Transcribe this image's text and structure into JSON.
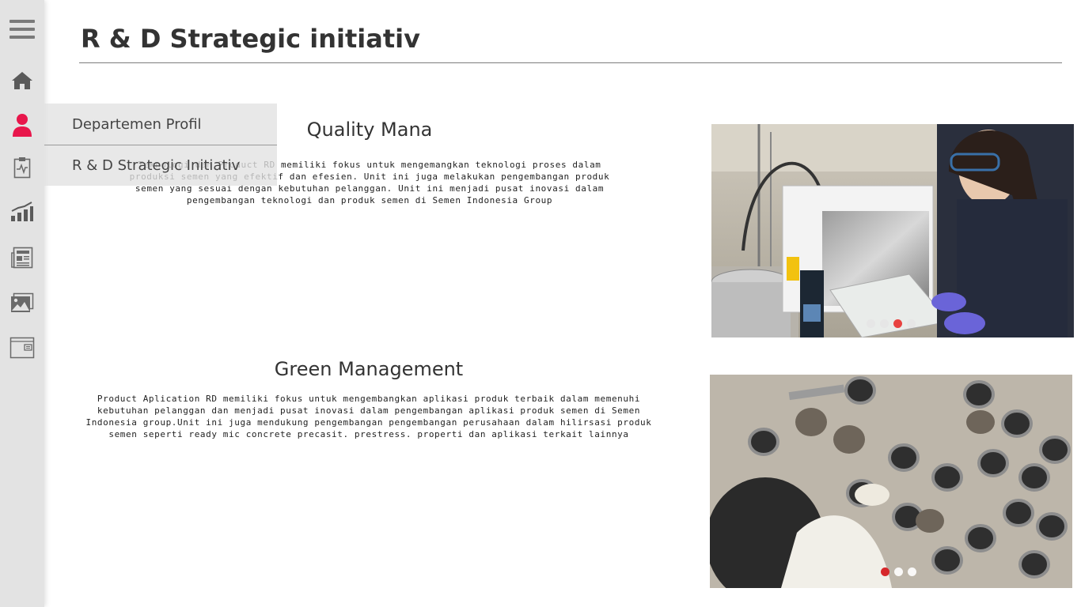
{
  "header": {
    "title": "R & D Strategic initiativ"
  },
  "sidebar": {
    "items": [
      {
        "icon": "menu-icon"
      },
      {
        "icon": "home-icon"
      },
      {
        "icon": "user-icon",
        "active": true,
        "active_color": "#e8164b"
      },
      {
        "icon": "clipboard-icon"
      },
      {
        "icon": "chart-icon"
      },
      {
        "icon": "newspaper-icon"
      },
      {
        "icon": "gallery-icon"
      },
      {
        "icon": "window-icon"
      }
    ]
  },
  "dropdown": {
    "items": [
      {
        "label": "Departemen Profil"
      },
      {
        "label": "R & D Strategic Initiativ"
      }
    ]
  },
  "sections": [
    {
      "title": "Quality Mana",
      "text": "Teknologi dan Product RD memiliki fokus untuk mengemangkan teknologi proses dalam produksi semen yang efektif dan efesien. Unit ini juga melakukan pengembangan produk semen yang sesuai dengan kebutuhan pelanggan. Unit ini menjadi pusat inovasi dalam pengembangan teknologi dan produk semen di Semen Indonesia Group",
      "carousel": {
        "slides": 4,
        "active_index": 2
      }
    },
    {
      "title": "Green Management",
      "text": "Product Aplication RD memiliki fokus untuk mengembangkan aplikasi produk terbaik dalam memenuhi kebutuhan pelanggan dan menjadi pusat inovasi dalam pengembangan aplikasi produk semen di Semen Indonesia group.Unit ini juga mendukung pengembangan pengembangan perusahaan dalam hilirsasi produk semen seperti ready mic concrete precasit. prestress. properti dan aplikasi terkait lainnya",
      "carousel": {
        "slides": 3,
        "active_index": 0
      }
    }
  ],
  "colors": {
    "accent": "#e8164b",
    "dot_active": "#e8423f"
  }
}
